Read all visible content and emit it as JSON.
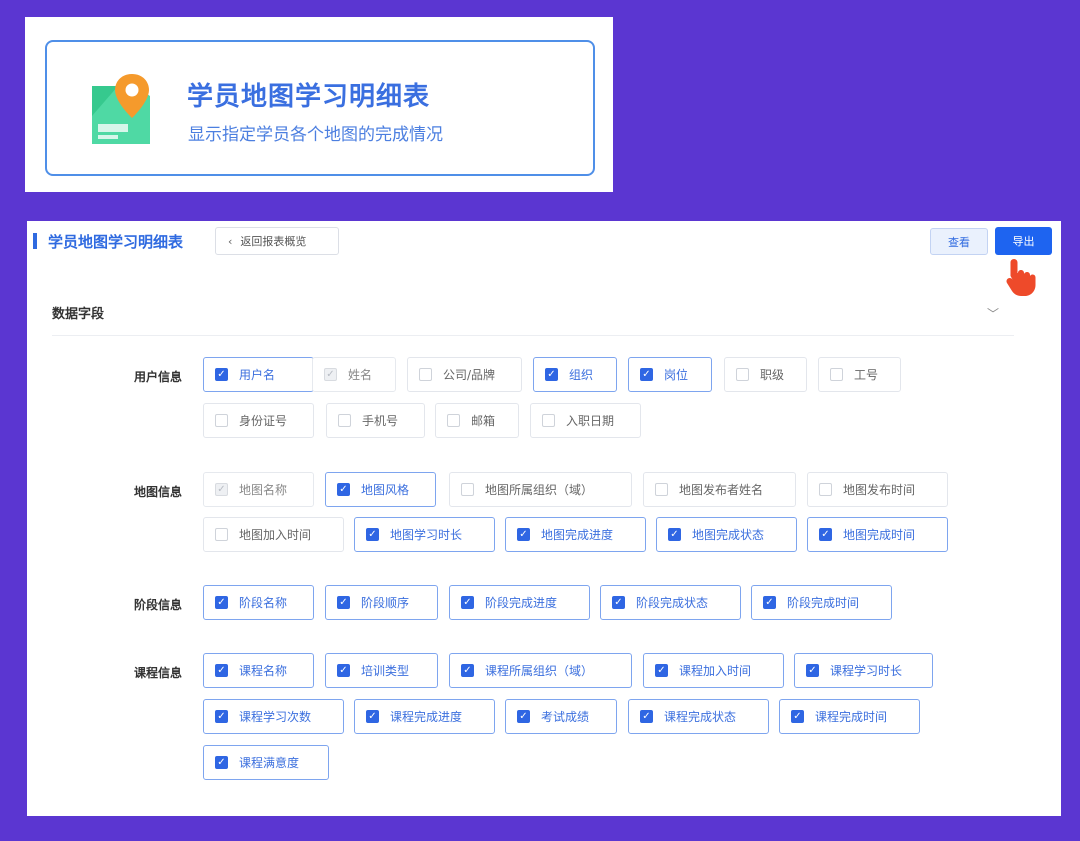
{
  "header_card": {
    "title": "学员地图学习明细表",
    "subtitle": "显示指定学员各个地图的完成情况",
    "icon": "map-pin-icon"
  },
  "toolbar": {
    "page_title": "学员地图学习明细表",
    "back_label": "返回报表概览",
    "view_label": "查看",
    "export_label": "导出"
  },
  "section": {
    "title": "数据字段",
    "collapse_icon": "chevron-down-icon"
  },
  "groups": [
    {
      "label": "用户信息",
      "fields": [
        {
          "label": "用户名",
          "state": "checked"
        },
        {
          "label": "姓名",
          "state": "disabled-checked"
        },
        {
          "label": "公司/品牌",
          "state": "unchecked"
        },
        {
          "label": "组织",
          "state": "checked"
        },
        {
          "label": "岗位",
          "state": "checked"
        },
        {
          "label": "职级",
          "state": "unchecked"
        },
        {
          "label": "工号",
          "state": "unchecked"
        },
        {
          "label": "身份证号",
          "state": "unchecked"
        },
        {
          "label": "手机号",
          "state": "unchecked"
        },
        {
          "label": "邮箱",
          "state": "unchecked"
        },
        {
          "label": "入职日期",
          "state": "unchecked"
        }
      ]
    },
    {
      "label": "地图信息",
      "fields": [
        {
          "label": "地图名称",
          "state": "disabled-checked"
        },
        {
          "label": "地图风格",
          "state": "checked"
        },
        {
          "label": "地图所属组织（域）",
          "state": "unchecked"
        },
        {
          "label": "地图发布者姓名",
          "state": "unchecked"
        },
        {
          "label": "地图发布时间",
          "state": "unchecked"
        },
        {
          "label": "地图加入时间",
          "state": "unchecked"
        },
        {
          "label": "地图学习时长",
          "state": "checked"
        },
        {
          "label": "地图完成进度",
          "state": "checked"
        },
        {
          "label": "地图完成状态",
          "state": "checked"
        },
        {
          "label": "地图完成时间",
          "state": "checked"
        }
      ]
    },
    {
      "label": "阶段信息",
      "fields": [
        {
          "label": "阶段名称",
          "state": "checked"
        },
        {
          "label": "阶段顺序",
          "state": "checked"
        },
        {
          "label": "阶段完成进度",
          "state": "checked"
        },
        {
          "label": "阶段完成状态",
          "state": "checked"
        },
        {
          "label": "阶段完成时间",
          "state": "checked"
        }
      ]
    },
    {
      "label": "课程信息",
      "fields": [
        {
          "label": "课程名称",
          "state": "checked"
        },
        {
          "label": "培训类型",
          "state": "checked"
        },
        {
          "label": "课程所属组织（域）",
          "state": "checked"
        },
        {
          "label": "课程加入时间",
          "state": "checked"
        },
        {
          "label": "课程学习时长",
          "state": "checked"
        },
        {
          "label": "课程学习次数",
          "state": "checked"
        },
        {
          "label": "课程完成进度",
          "state": "checked"
        },
        {
          "label": "考试成绩",
          "state": "checked"
        },
        {
          "label": "课程完成状态",
          "state": "checked"
        },
        {
          "label": "课程完成时间",
          "state": "checked"
        },
        {
          "label": "课程满意度",
          "state": "checked"
        }
      ]
    }
  ],
  "colors": {
    "background": "#5b36d1",
    "accent": "#2f6ae0",
    "export_button": "#1e64f0",
    "cursor": "#ee4a2a"
  }
}
